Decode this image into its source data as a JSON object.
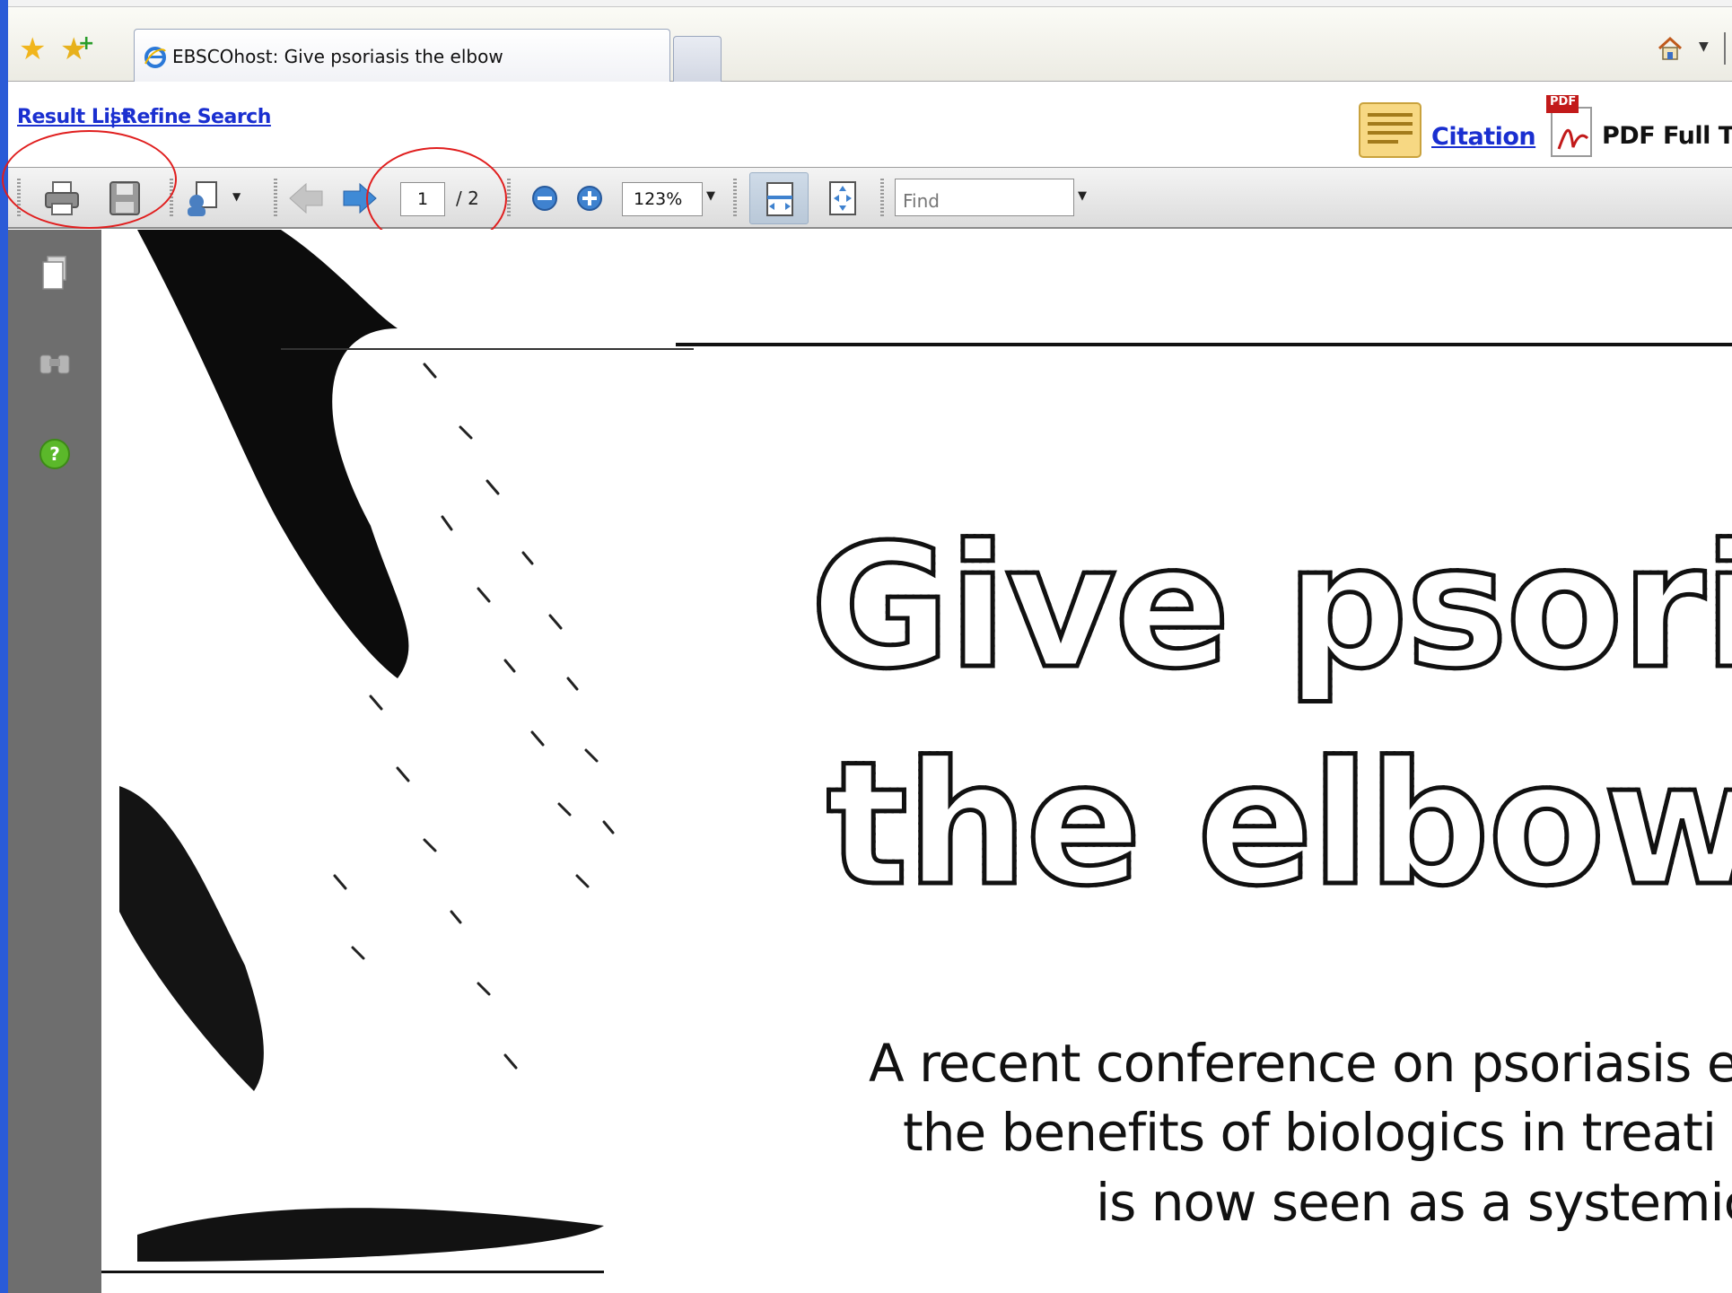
{
  "browser": {
    "tab_title": "EBSCOhost: Give psoriasis the elbow",
    "icons": [
      "favorites-star-icon",
      "add-favorites-icon",
      "ie-icon",
      "home-icon"
    ]
  },
  "nav": {
    "result_list": "Result List",
    "separator": "|",
    "refine_search": "Refine Search",
    "citation": "Citation",
    "pdf_full_text": "PDF Full T",
    "pdf_badge": "PDF"
  },
  "toolbar": {
    "current_page": "1",
    "page_total": "/ 2",
    "zoom": "123%",
    "find_placeholder": "Find"
  },
  "document": {
    "headline_line1": "Give psorias",
    "headline_line2": "the elbow",
    "deck_line1": "A recent conference on psoriasis e",
    "deck_line2": "the benefits of biologics in treati",
    "deck_line3": "is now seen as a systemic"
  },
  "colors": {
    "link": "#1a2fd0",
    "annotation": "#e01e1e",
    "sidebar": "#6e6e6e",
    "frame": "#2a5bd7"
  }
}
